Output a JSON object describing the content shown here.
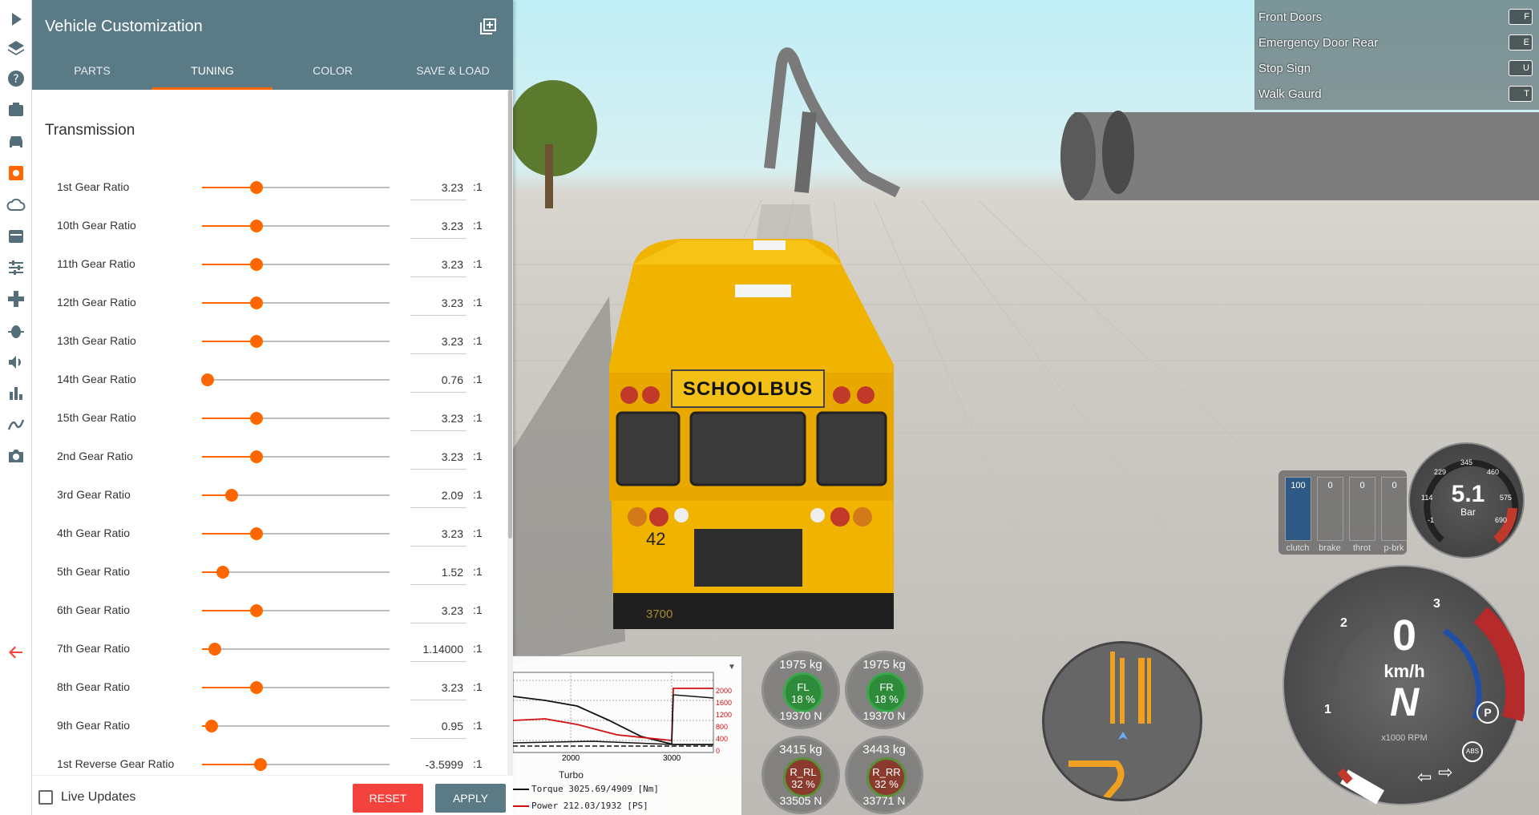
{
  "panel": {
    "title": "Vehicle Customization",
    "tabs": [
      "PARTS",
      "TUNING",
      "COLOR",
      "SAVE & LOAD"
    ],
    "active_tab": "TUNING",
    "section_title": "Transmission",
    "unit": ":1",
    "rows": [
      {
        "label": "1st Gear Ratio",
        "value": "3.23",
        "fraction": 0.29
      },
      {
        "label": "10th Gear Ratio",
        "value": "3.23",
        "fraction": 0.29
      },
      {
        "label": "11th Gear Ratio",
        "value": "3.23",
        "fraction": 0.29
      },
      {
        "label": "12th Gear Ratio",
        "value": "3.23",
        "fraction": 0.29
      },
      {
        "label": "13th Gear Ratio",
        "value": "3.23",
        "fraction": 0.29
      },
      {
        "label": "14th Gear Ratio",
        "value": "0.76",
        "fraction": 0.03
      },
      {
        "label": "15th Gear Ratio",
        "value": "3.23",
        "fraction": 0.29
      },
      {
        "label": "2nd Gear Ratio",
        "value": "3.23",
        "fraction": 0.29
      },
      {
        "label": "3rd Gear Ratio",
        "value": "2.09",
        "fraction": 0.16
      },
      {
        "label": "4th Gear Ratio",
        "value": "3.23",
        "fraction": 0.29
      },
      {
        "label": "5th Gear Ratio",
        "value": "1.52",
        "fraction": 0.11
      },
      {
        "label": "6th Gear Ratio",
        "value": "3.23",
        "fraction": 0.29
      },
      {
        "label": "7th Gear Ratio",
        "value": "1.14000",
        "fraction": 0.07
      },
      {
        "label": "8th Gear Ratio",
        "value": "3.23",
        "fraction": 0.29
      },
      {
        "label": "9th Gear Ratio",
        "value": "0.95",
        "fraction": 0.05
      },
      {
        "label": "1st Reverse Gear Ratio",
        "value": "-3.5999",
        "fraction": 0.31
      }
    ],
    "live_updates_label": "Live Updates",
    "reset_label": "RESET",
    "apply_label": "APPLY"
  },
  "rail_icons": [
    "play-icon",
    "layers-icon",
    "help-icon",
    "replay-icon",
    "car-icon",
    "parts-config-icon",
    "weather-icon",
    "environment-icon",
    "tuning-sliders-icon",
    "controls-icon",
    "debug-icon",
    "audio-icon",
    "stats-icon",
    "track-builder-icon",
    "camera-icon",
    "back-arrow-icon"
  ],
  "actions": [
    {
      "label": "Front Doors",
      "key": "F"
    },
    {
      "label": "Emergency Door Rear",
      "key": "E"
    },
    {
      "label": "Stop Sign",
      "key": "U"
    },
    {
      "label": "Walk Gaurd",
      "key": "T"
    }
  ],
  "bus": {
    "sign": "SCHOOLBUS",
    "number": "42",
    "plate": "3700"
  },
  "pedals": [
    {
      "label": "clutch",
      "value": "100",
      "level": 1.0
    },
    {
      "label": "brake",
      "value": "0",
      "level": 0
    },
    {
      "label": "throt",
      "value": "0",
      "level": 0
    },
    {
      "label": "p-brk",
      "value": "0",
      "level": 0
    }
  ],
  "turbo_gauge": {
    "value": "5.1",
    "unit": "Bar",
    "ticks": [
      "229",
      "345",
      "460",
      "114",
      "575",
      "-1",
      "690"
    ]
  },
  "speedo": {
    "speed": "0",
    "unit": "km/h",
    "gear": "N",
    "rpm_label": "x1000 RPM",
    "ticks": [
      "1",
      "2",
      "3"
    ],
    "abs": "ABS",
    "park": "P"
  },
  "wheels": [
    {
      "name": "FL",
      "mass": "1975 kg",
      "pct": "18 %",
      "force": "19370 N"
    },
    {
      "name": "FR",
      "mass": "1975 kg",
      "pct": "18 %",
      "force": "19370 N"
    },
    {
      "name": "R_RL",
      "mass": "3415 kg",
      "pct": "32 %",
      "force": "33505 N"
    },
    {
      "name": "R_RR",
      "mass": "3443 kg",
      "pct": "32 %",
      "force": "33771 N"
    }
  ],
  "graph": {
    "title": "Turbo",
    "x_ticks": [
      "2000",
      "3000"
    ],
    "y_ticks": [
      "2000",
      "1600",
      "1200",
      "800",
      "400",
      "0"
    ],
    "torque_legend": "Torque 3025.69/4909 [Nm]",
    "power_legend": "Power 212.03/1932  [PS]"
  },
  "colors": {
    "accent": "#ff6600",
    "header": "#5a7a86",
    "reset": "#f4433c"
  }
}
